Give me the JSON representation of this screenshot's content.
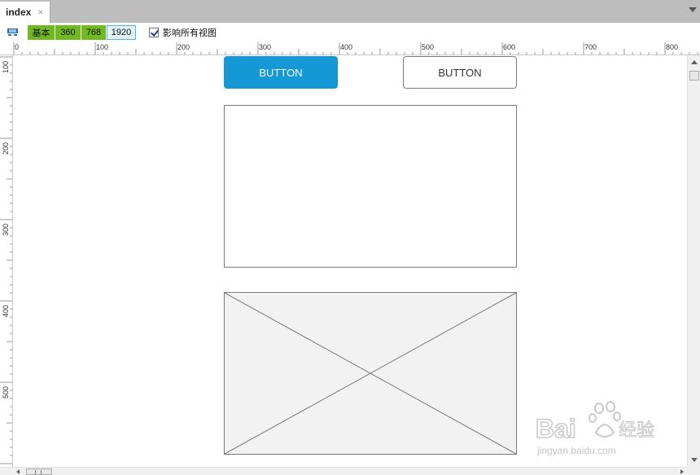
{
  "tab": {
    "title": "index",
    "close_glyph": "×"
  },
  "toolbar": {
    "adaptive_icon": "adaptive-view-icon",
    "breakpoints": [
      "基本",
      "360",
      "768",
      "1920"
    ],
    "active_breakpoint": "1920",
    "affect_all_checked": true,
    "affect_all_label": "影响所有视图"
  },
  "ruler": {
    "x_labels": [
      "0",
      "100",
      "200",
      "300",
      "400",
      "500",
      "600",
      "700",
      "800"
    ],
    "y_labels": [
      "100",
      "200",
      "300",
      "400",
      "500"
    ]
  },
  "canvas": {
    "primary_button_label": "BUTTON",
    "secondary_button_label": "BUTTON",
    "rectangle_widget": "rectangle",
    "image_widget": "image-placeholder"
  },
  "watermark": {
    "brand": "Bai",
    "brand_cn": "经验",
    "url": "jingyan.baidu.com"
  },
  "colors": {
    "primary_button": "#1598d6",
    "breakpoint_green": "#72b820",
    "active_breakpoint_bg": "#dff1fb",
    "tabbar_bg": "#bdbdbd",
    "image_placeholder_bg": "#f2f2f2",
    "widget_border": "#797979"
  }
}
